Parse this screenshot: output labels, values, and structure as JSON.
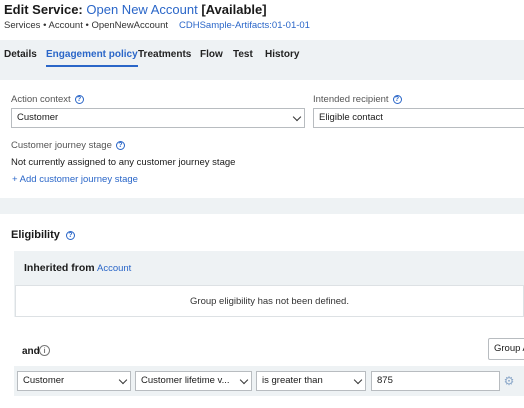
{
  "header": {
    "title_prefix": "Edit Service:",
    "title_link": "Open New Account",
    "status": "[Available]",
    "breadcrumb": "Services • Account • OpenNewAccount",
    "version": "CDHSample-Artifacts:01-01-01"
  },
  "tabs": [
    {
      "label": "Details"
    },
    {
      "label": "Engagement policy"
    },
    {
      "label": "Treatments"
    },
    {
      "label": "Flow"
    },
    {
      "label": "Test"
    },
    {
      "label": "History"
    }
  ],
  "active_tab": "Engagement policy",
  "context": {
    "action_context_label": "Action context",
    "action_context_value": "Customer",
    "intended_recipient_label": "Intended recipient",
    "intended_recipient_value": "Eligible contact",
    "journey_label": "Customer journey stage",
    "journey_status": "Not currently assigned to any customer journey stage",
    "add_journey": "+ Add customer journey stage"
  },
  "eligibility": {
    "title": "Eligibility",
    "inherited_label": "Inherited from",
    "inherited_link": "Account",
    "inherited_message": "Group eligibility has not been defined.",
    "and_label": "and",
    "group_button": "Group A",
    "condition": {
      "entity": "Customer",
      "property": "Customer lifetime v...",
      "operator": "is greater than",
      "value": "875"
    }
  },
  "colors": {
    "accent": "#2a66c8",
    "panel_bg": "#eef2f4"
  }
}
